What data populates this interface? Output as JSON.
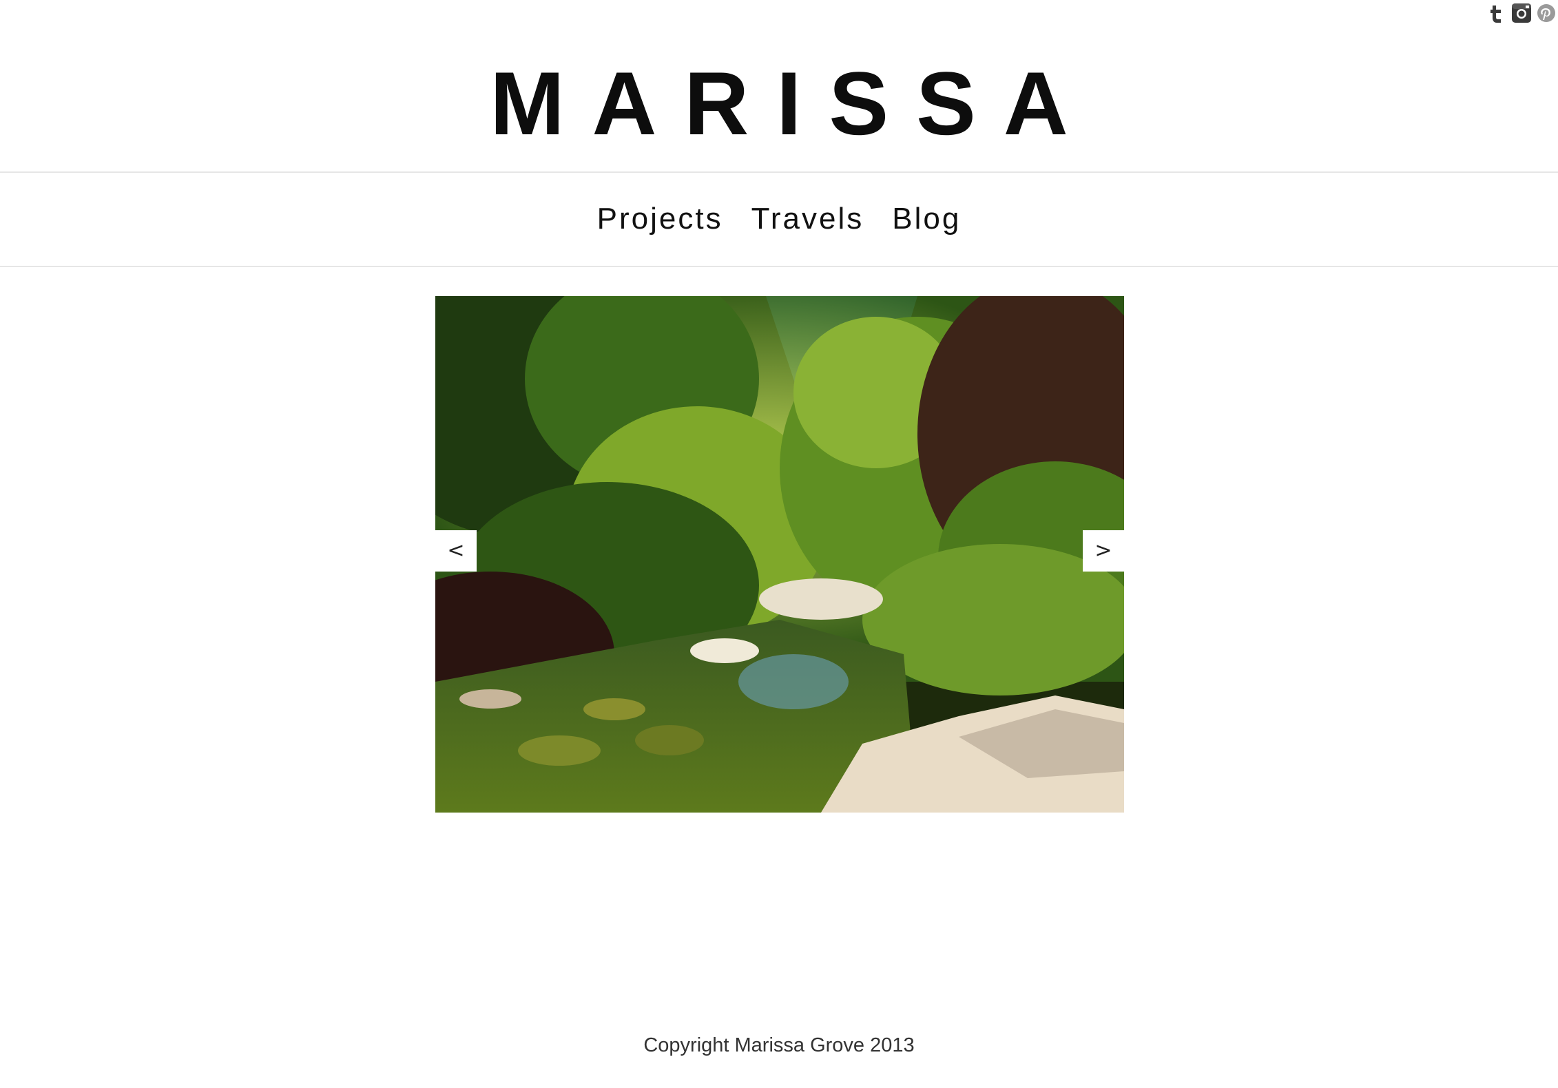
{
  "social": [
    {
      "name": "tumblr-icon",
      "label": "t"
    },
    {
      "name": "instagram-icon",
      "label": ""
    },
    {
      "name": "pinterest-icon",
      "label": "P"
    }
  ],
  "header": {
    "title": "MARISSA"
  },
  "nav": {
    "items": [
      "Projects",
      "Travels",
      "Blog"
    ]
  },
  "slideshow": {
    "prev_label": "<",
    "next_label": ">"
  },
  "footer": {
    "copyright": "Copyright Marissa Grove 2013"
  }
}
